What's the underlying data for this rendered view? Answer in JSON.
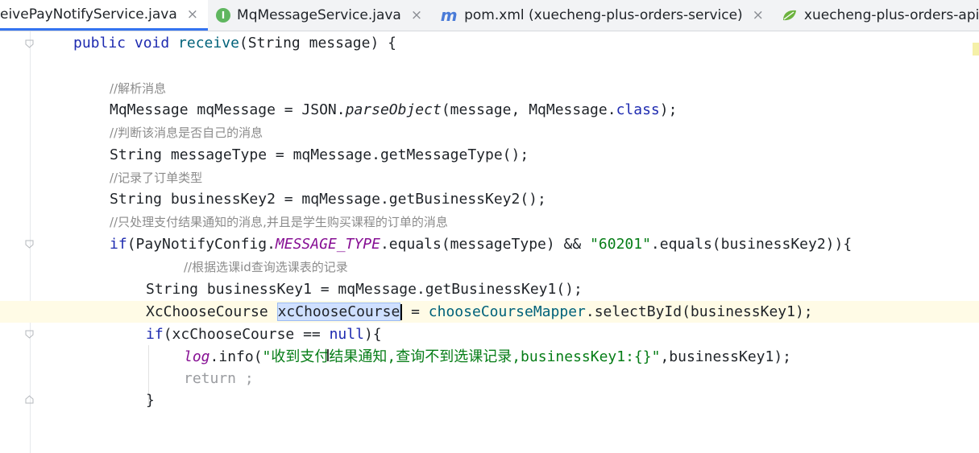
{
  "tabs": [
    {
      "label": "eivePayNotifyService.java",
      "icon": "none",
      "active": true
    },
    {
      "label": "MqMessageService.java",
      "icon": "interface-i-icon",
      "active": false
    },
    {
      "label": "pom.xml (xuecheng-plus-orders-service)",
      "icon": "maven-m-icon",
      "active": false
    },
    {
      "label": "xuecheng-plus-orders-api\\...\\bootstra",
      "icon": "spring-leaf-icon",
      "active": false
    }
  ],
  "tab_close": "×",
  "code": {
    "l1_a": "public void ",
    "l1_b": "receive",
    "l1_c": "(String message) {",
    "c1": "//解析消息",
    "l2_a": "MqMessage mqMessage = JSON.",
    "l2_b": "parseObject",
    "l2_c": "(message, MqMessage.",
    "l2_d": "class",
    "l2_e": ");",
    "c2": "//判断该消息是否自己的消息",
    "l3": "String messageType = mqMessage.getMessageType();",
    "c3": "//记录了订单类型",
    "l4": "String businessKey2 = mqMessage.getBusinessKey2();",
    "c4": "//只处理支付结果通知的消息,并且是学生购买课程的订单的消息",
    "l5_a": "if",
    "l5_b": "(PayNotifyConfig.",
    "l5_c": "MESSAGE_TYPE",
    "l5_d": ".equals(messageType) && ",
    "l5_e": "\"60201\"",
    "l5_f": ".equals(businessKey2)){",
    "c5": "//根据选课id查询选课表的记录",
    "l6": "String businessKey1 = mqMessage.getBusinessKey1();",
    "l7_a": "XcChooseCourse ",
    "l7_b": "xcChooseCourse",
    "l7_c": " = ",
    "l7_d": "chooseCourseMapper",
    "l7_e": ".selectById(businessKey1);",
    "l8_a": "if",
    "l8_b": "(xcChooseCourse == ",
    "l8_c": "null",
    "l8_d": "){",
    "l9_a": "log",
    "l9_b": ".info(",
    "l9_c": "\"收到支付结果通知,查询不到选课记录,businessKey1:{}\"",
    "l9_d": ",businessKey1);",
    "l10": "return ;",
    "l11": "}"
  },
  "colors": {
    "keyword": "#1e2bb0",
    "string": "#067d17",
    "comment": "#8c8c8c",
    "field": "#871094",
    "selection": "#cfe0ff",
    "tab_accent": "#3574f0"
  }
}
